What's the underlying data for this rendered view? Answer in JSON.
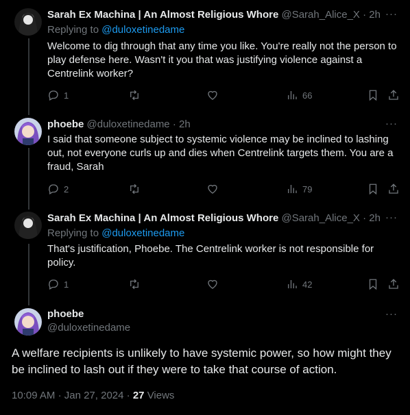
{
  "tweets": [
    {
      "author_name": "Sarah Ex Machina | An Almost Religious Whore",
      "author_handle": "@Sarah_Alice_X",
      "time": "2h",
      "replying_to_label": "Replying to",
      "replying_to": "@duloxetinedame",
      "text": "Welcome to dig through that any time you like. You're really not the person to play defense here. Wasn't it you that was justifying violence against a Centrelink worker?",
      "reply_count": "1",
      "views": "66"
    },
    {
      "author_name": "phoebe",
      "author_handle": "@duloxetinedame",
      "time": "2h",
      "text": "I said that someone subject to systemic violence may be inclined to lashing out, not everyone curls up and dies when Centrelink targets them. You are a fraud, Sarah",
      "reply_count": "2",
      "views": "79"
    },
    {
      "author_name": "Sarah Ex Machina | An Almost Religious Whore",
      "author_handle": "@Sarah_Alice_X",
      "time": "2h",
      "replying_to_label": "Replying to",
      "replying_to": "@duloxetinedame",
      "text": "That's justification, Phoebe. The Centrelink worker is not responsible for policy.",
      "reply_count": "1",
      "views": "42"
    }
  ],
  "main": {
    "author_name": "phoebe",
    "author_handle": "@duloxetinedame",
    "text": "A welfare recipients is unlikely to have systemic power, so how might they be inclined to lash out if they were to take that course of action.",
    "time": "10:09 AM",
    "date": "Jan 27, 2024",
    "views_count": "27",
    "views_label": "Views"
  },
  "icons": [
    "reply-icon",
    "retweet-icon",
    "like-icon",
    "views-icon",
    "bookmark-icon",
    "share-icon",
    "more-icon"
  ]
}
